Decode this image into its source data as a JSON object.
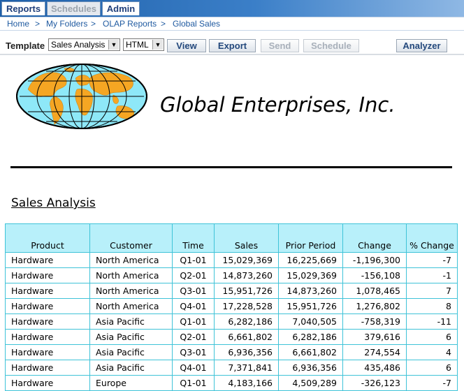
{
  "tabs": [
    {
      "label": "Reports",
      "state": "active"
    },
    {
      "label": "Schedules",
      "state": "inactive"
    },
    {
      "label": "Admin",
      "state": "normal"
    }
  ],
  "breadcrumb": [
    "Home",
    "My Folders",
    "OLAP Reports",
    "Global Sales"
  ],
  "breadcrumb_separator": ">",
  "toolbar": {
    "template_label": "Template",
    "template_value": "Sales Analysis",
    "format_value": "HTML",
    "buttons": {
      "view": "View",
      "export": "Export",
      "send": "Send",
      "schedule": "Schedule",
      "analyzer": "Analyzer"
    }
  },
  "report": {
    "company": "Global Enterprises, Inc.",
    "title": "Sales Analysis",
    "columns": [
      "Product",
      "Customer",
      "Time",
      "Sales",
      "Prior Period",
      "Change",
      "% Change"
    ],
    "rows": [
      [
        "Hardware",
        "North America",
        "Q1-01",
        "15,029,369",
        "16,225,669",
        "-1,196,300",
        "-7"
      ],
      [
        "Hardware",
        "North America",
        "Q2-01",
        "14,873,260",
        "15,029,369",
        "-156,108",
        "-1"
      ],
      [
        "Hardware",
        "North America",
        "Q3-01",
        "15,951,726",
        "14,873,260",
        "1,078,465",
        "7"
      ],
      [
        "Hardware",
        "North America",
        "Q4-01",
        "17,228,528",
        "15,951,726",
        "1,276,802",
        "8"
      ],
      [
        "Hardware",
        "Asia Pacific",
        "Q1-01",
        "6,282,186",
        "7,040,505",
        "-758,319",
        "-11"
      ],
      [
        "Hardware",
        "Asia Pacific",
        "Q2-01",
        "6,661,802",
        "6,282,186",
        "379,616",
        "6"
      ],
      [
        "Hardware",
        "Asia Pacific",
        "Q3-01",
        "6,936,356",
        "6,661,802",
        "274,554",
        "4"
      ],
      [
        "Hardware",
        "Asia Pacific",
        "Q4-01",
        "7,371,841",
        "6,936,356",
        "435,486",
        "6"
      ],
      [
        "Hardware",
        "Europe",
        "Q1-01",
        "4,183,166",
        "4,509,289",
        "-326,123",
        "-7"
      ]
    ]
  },
  "colors": {
    "accent": "#1e5fa8",
    "table_header": "#b8f0fa",
    "table_border": "#3fc3d8",
    "globe_land": "#f5a623",
    "globe_water": "#8ee8f8"
  },
  "icons": {
    "logo": "world-map-globe-icon",
    "dropdown": "chevron-down-icon"
  }
}
